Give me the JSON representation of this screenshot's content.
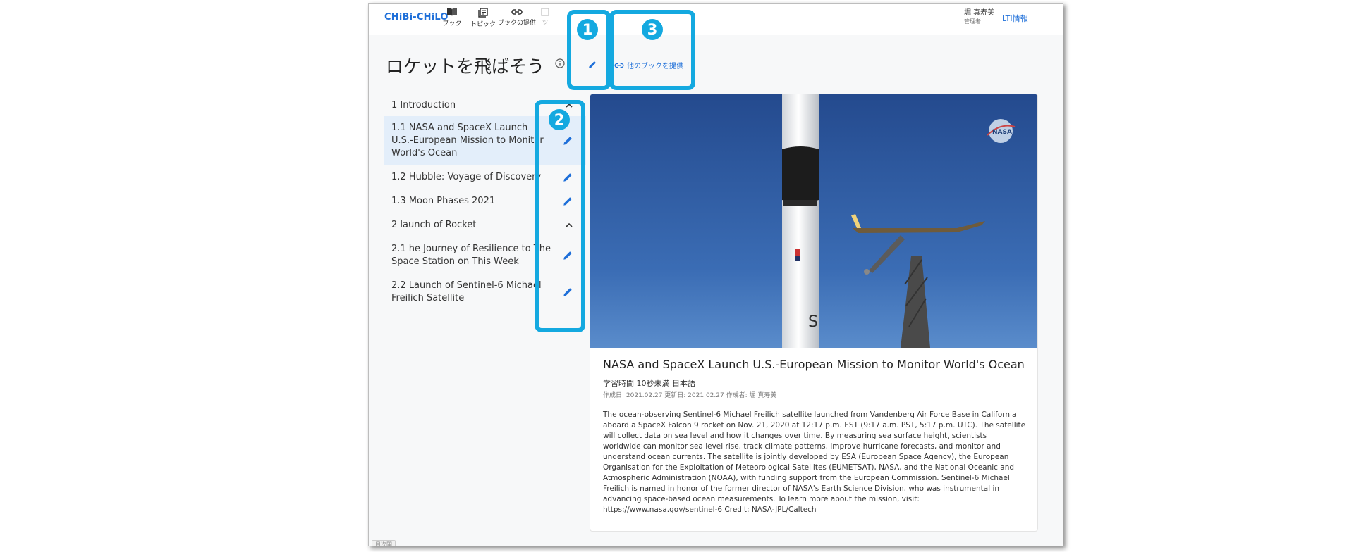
{
  "app": {
    "logo": "CHiBi-CHiLO",
    "nav": [
      {
        "label": "ブック",
        "icon": "book-icon"
      },
      {
        "label": "トピック",
        "icon": "topics-icon"
      },
      {
        "label": "ブックの提供",
        "icon": "link-icon"
      },
      {
        "label": "ツ",
        "icon": "tool-icon"
      }
    ],
    "user": {
      "name": "堀 真寿美",
      "role": "管理者"
    },
    "lti_link": "LTI情報"
  },
  "book": {
    "title": "ロケットを飛ばそう",
    "share_label": "他のブックを提供"
  },
  "toc": [
    {
      "label": "1 Introduction",
      "type": "section"
    },
    {
      "label": "1.1 NASA and SpaceX Launch U.S.-European Mission to Monitor World's Ocean",
      "type": "topic",
      "active": true
    },
    {
      "label": "1.2 Hubble: Voyage of Discovery",
      "type": "topic"
    },
    {
      "label": "1.3 Moon Phases 2021",
      "type": "topic"
    },
    {
      "label": "2 launch of Rocket",
      "type": "section"
    },
    {
      "label": "2.1 he Journey of Resilience to The Space Station on This Week",
      "type": "topic"
    },
    {
      "label": "2.2 Launch of Sentinel-6 Michael Freilich Satellite",
      "type": "topic"
    }
  ],
  "content": {
    "title": "NASA and SpaceX Launch U.S.-European Mission to Monitor World's Ocean",
    "meta": "学習時間 10秒未満  日本語",
    "dates": "作成日: 2021.02.27   更新日: 2021.02.27   作成者: 堀 真寿美",
    "description": "The ocean-observing Sentinel-6 Michael Freilich satellite launched from Vandenberg Air Force Base in California aboard a SpaceX Falcon 9 rocket on Nov. 21, 2020 at 12:17 p.m. EST (9:17 a.m. PST, 5:17 p.m. UTC). The satellite will collect data on sea level and how it changes over time. By measuring sea surface height, scientists worldwide can monitor sea level rise, track climate patterns, improve hurricane forecasts, and monitor and understand ocean currents. The satellite is jointly developed by ESA (European Space Agency), the European Organisation for the Exploitation of Meteorological Satellites (EUMETSAT), NASA, and the National Oceanic and Atmospheric Administration (NOAA), with funding support from the European Commission. Sentinel-6 Michael Freilich is named in honor of the former director of NASA's Earth Science Division, who was instrumental in advancing space-based ocean measurements. To learn more about the mission, visit: https://www.nasa.gov/sentinel-6 Credit: NASA-JPL/Caltech",
    "video_logo": "NASA"
  },
  "bottom_tab": "目次開",
  "callouts": [
    {
      "number": "1"
    },
    {
      "number": "2"
    },
    {
      "number": "3"
    }
  ],
  "colors": {
    "accent": "#1e6fd9",
    "callout": "#14a9e0",
    "active_row": "#e3eefa"
  }
}
